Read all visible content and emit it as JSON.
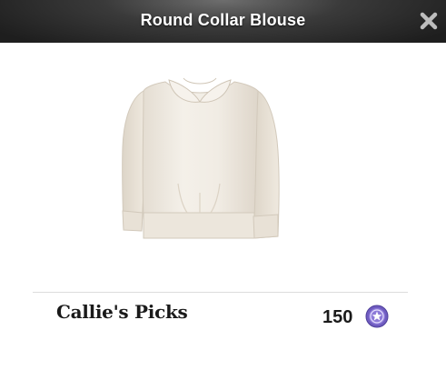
{
  "dialog": {
    "title": "Round Collar Blouse",
    "close_icon": "close-icon"
  },
  "product": {
    "image_icon": "blouse-image",
    "brand": "Callie's Picks",
    "price": "150",
    "currency_icon": "star-coin-icon"
  },
  "colors": {
    "titlebar": "#2a2a2a",
    "coin": "#7b68c8",
    "blouse": "#efe9df"
  }
}
